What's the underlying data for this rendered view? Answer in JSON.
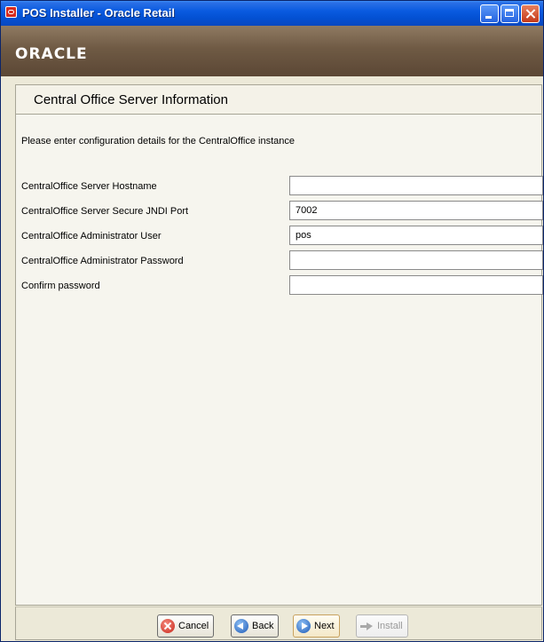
{
  "window": {
    "title": "POS Installer - Oracle Retail"
  },
  "brand": {
    "logo_text": "ORACLE"
  },
  "page": {
    "title": "Central Office Server Information",
    "instructions": "Please enter configuration details for the CentralOffice instance"
  },
  "fields": [
    {
      "label": "CentralOffice Server Hostname",
      "value": ""
    },
    {
      "label": "CentralOffice Server Secure JNDI Port",
      "value": "7002"
    },
    {
      "label": "CentralOffice Administrator User",
      "value": "pos"
    },
    {
      "label": "CentralOffice Administrator Password",
      "value": ""
    },
    {
      "label": "Confirm password",
      "value": ""
    }
  ],
  "buttons": {
    "cancel": "Cancel",
    "back": "Back",
    "next": "Next",
    "install": "Install"
  },
  "icons": {
    "app": "oracle-app-icon",
    "cancel": "cancel-icon",
    "back": "back-arrow-icon",
    "next": "next-arrow-icon",
    "install": "install-arrow-icon"
  },
  "colors": {
    "titlebar": "#0a5be0",
    "logo_band": "#6f5a44",
    "panel_bg": "#f6f5ee",
    "window_bg": "#ece9d8"
  },
  "state": {
    "install_enabled": false
  }
}
